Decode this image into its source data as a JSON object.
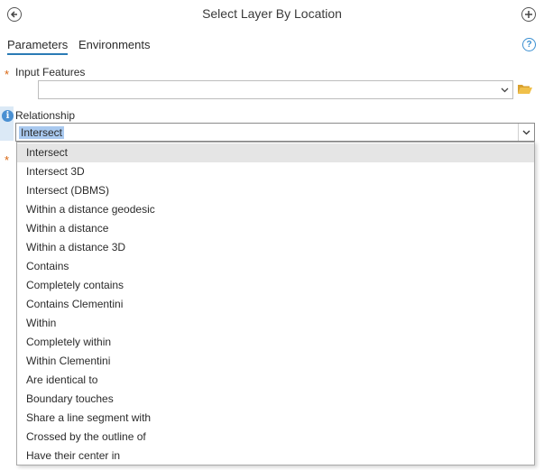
{
  "header": {
    "title": "Select Layer By Location"
  },
  "tabs": [
    {
      "label": "Parameters",
      "active": true
    },
    {
      "label": "Environments",
      "active": false
    }
  ],
  "params": {
    "input_features": {
      "label": "Input Features",
      "required_mark": "*",
      "value": ""
    },
    "relationship": {
      "label": "Relationship",
      "value": "Intersect"
    },
    "hidden_required_mark": "*"
  },
  "dropdown": {
    "options": [
      "Intersect",
      "Intersect 3D",
      "Intersect (DBMS)",
      "Within a distance geodesic",
      "Within a distance",
      "Within a distance 3D",
      "Contains",
      "Completely contains",
      "Contains Clementini",
      "Within",
      "Completely within",
      "Within Clementini",
      "Are identical to",
      "Boundary touches",
      "Share a line segment with",
      "Crossed by the outline of",
      "Have their center in"
    ]
  },
  "colors": {
    "accent": "#2a7bb5",
    "required": "#d9640e",
    "selection": "#a9c9ef",
    "hover": "#e5e5e5",
    "folder": "#e7b23c"
  },
  "icons": {
    "back": "back-arrow-icon",
    "add": "plus-circle-icon",
    "help": "help-icon",
    "folder": "folder-open-icon",
    "info": "info-icon",
    "chevron": "chevron-down-icon"
  }
}
